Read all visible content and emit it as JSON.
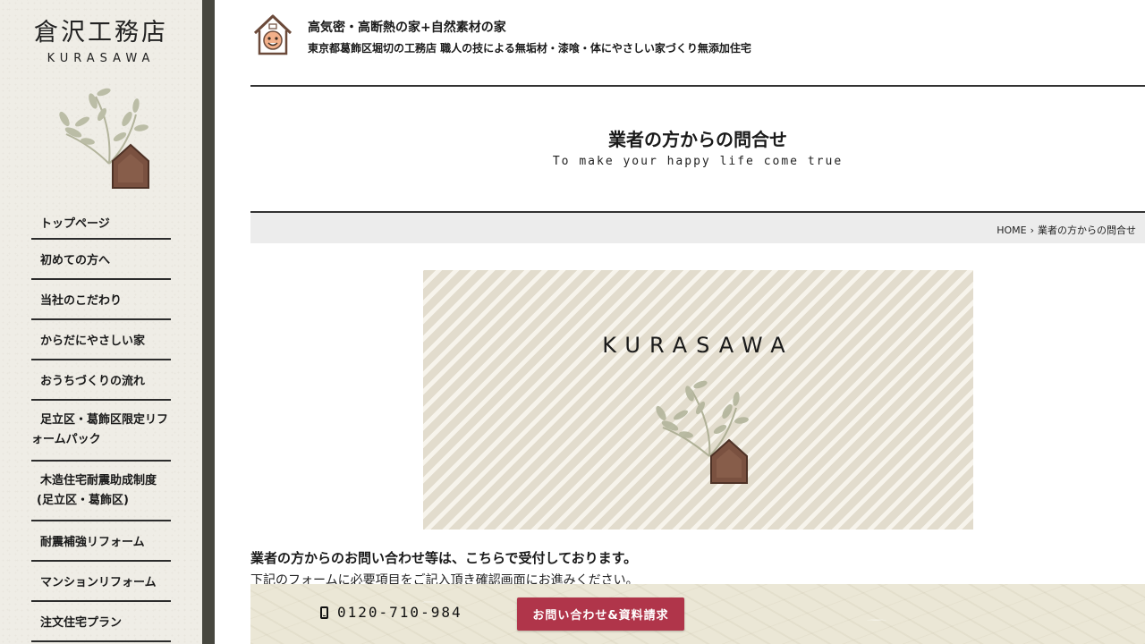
{
  "sidebar": {
    "logo_title": "倉沢工務店",
    "logo_sub": "KURASAWA",
    "nav": [
      {
        "label": "トップページ"
      },
      {
        "label": "初めての方へ"
      },
      {
        "label": "当社のこだわり"
      },
      {
        "label": "からだにやさしい家"
      },
      {
        "label": "おうちづくりの流れ"
      },
      {
        "label_1": "足立区・葛飾区限定リフ",
        "label_2": "ォームパック"
      },
      {
        "label_1": "木造住宅耐震助成制度",
        "label_2": "(足立区・葛飾区)"
      },
      {
        "label": "耐震補強リフォーム"
      },
      {
        "label": "マンションリフォーム"
      },
      {
        "label": "注文住宅プラン"
      }
    ]
  },
  "header": {
    "title": "高気密・高断熱の家+自然素材の家",
    "subtitle": "東京都葛飾区堀切の工務店 職人の技による無垢材・漆喰・体にやさしい家づくり無添加住宅"
  },
  "page": {
    "title": "業者の方からの問合せ",
    "subtitle": "To make your happy life come true"
  },
  "breadcrumb": {
    "home": "HOME",
    "separator": "›",
    "current": "業者の方からの問合せ"
  },
  "hero": {
    "word": "KURASAWA"
  },
  "intro": {
    "line1": "業者の方からのお問い合わせ等は、こちらで受付しております。",
    "line2": "下記のフォームに必要項目をご記入頂き確認画面にお進みください。"
  },
  "cta": {
    "phone": "0120-710-984",
    "button": "お問い合わせ&資料請求"
  },
  "colors": {
    "accent": "#b0354a",
    "sidebar_edge": "#47473f",
    "leaf": "#b3b59c",
    "house": "#7a5140"
  }
}
